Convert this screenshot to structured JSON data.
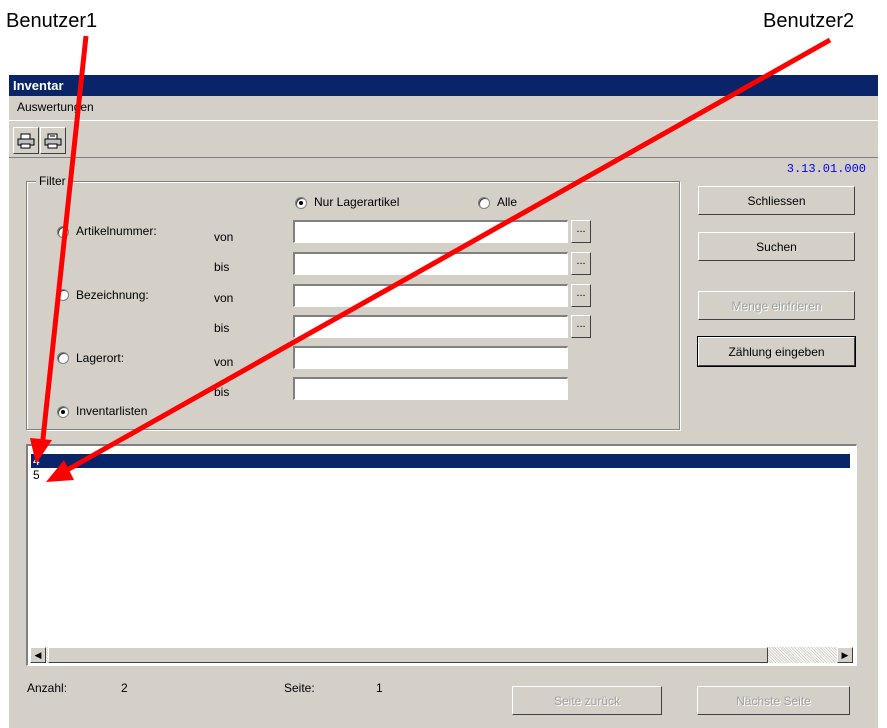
{
  "annotations": {
    "user1_label": "Benutzer1",
    "user2_label": "Benutzer2",
    "arrow_color": "#ff0000"
  },
  "window": {
    "title": "Inventar",
    "title_bg": "#0a246a",
    "menu": {
      "auswertungen": "Auswertungen"
    },
    "toolbar": {
      "print_icon": "printer-icon",
      "print_preview_icon": "printer-preview-icon"
    },
    "version": "3.13.01.000",
    "version_color": "#0000ff"
  },
  "filter": {
    "title": "Filter",
    "nur_lagerartikel": "Nur Lagerartikel",
    "alle": "Alle",
    "artikelnummer": "Artikelnummer:",
    "bezeichnung": "Bezeichnung:",
    "lagerort": "Lagerort:",
    "inventarlisten": "Inventarlisten",
    "von": "von",
    "bis": "bis",
    "ellipsis": "..."
  },
  "buttons": {
    "schliessen": "Schliessen",
    "suchen": "Suchen",
    "menge_einfrieren": "Menge einfrieren",
    "zaehlung_eingeben": "Zählung eingeben",
    "seite_zurueck": "Seite zurück",
    "naechste_seite": "Nächste Seite"
  },
  "list": {
    "items": [
      "4",
      "5"
    ],
    "selected_index": 0
  },
  "status": {
    "anzahl_label": "Anzahl:",
    "anzahl_value": "2",
    "seite_label": "Seite:",
    "seite_value": "1"
  },
  "scrollbar": {
    "left_icon": "arrow-left-icon",
    "right_icon": "arrow-right-icon"
  }
}
